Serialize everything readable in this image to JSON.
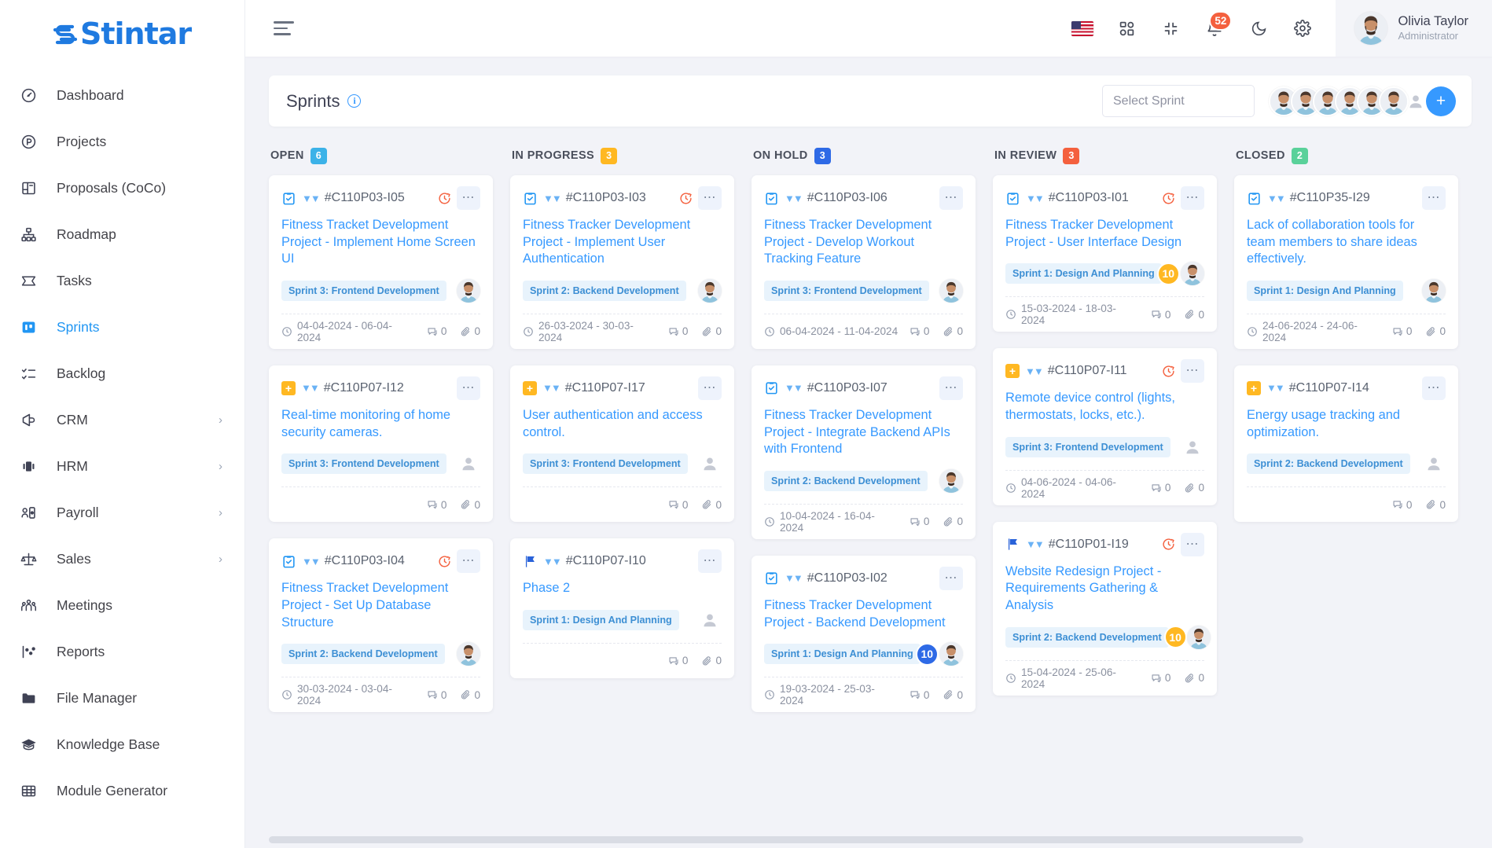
{
  "brand": {
    "name": "Stintar"
  },
  "sidebar": {
    "items": [
      {
        "label": "Dashboard",
        "icon": "gauge-icon",
        "active": false,
        "expandable": false
      },
      {
        "label": "Projects",
        "icon": "circle-p-icon",
        "active": false,
        "expandable": false
      },
      {
        "label": "Proposals (CoCo)",
        "icon": "layout-icon",
        "active": false,
        "expandable": false
      },
      {
        "label": "Roadmap",
        "icon": "sitemap-icon",
        "active": false,
        "expandable": false
      },
      {
        "label": "Tasks",
        "icon": "ticket-icon",
        "active": false,
        "expandable": false
      },
      {
        "label": "Sprints",
        "icon": "board-icon",
        "active": true,
        "expandable": false
      },
      {
        "label": "Backlog",
        "icon": "checklist-icon",
        "active": false,
        "expandable": false
      },
      {
        "label": "CRM",
        "icon": "megaphone-icon",
        "active": false,
        "expandable": true
      },
      {
        "label": "HRM",
        "icon": "id-card-icon",
        "active": false,
        "expandable": true
      },
      {
        "label": "Payroll",
        "icon": "user-card-icon",
        "active": false,
        "expandable": true
      },
      {
        "label": "Sales",
        "icon": "scale-icon",
        "active": false,
        "expandable": true
      },
      {
        "label": "Meetings",
        "icon": "people-icon",
        "active": false,
        "expandable": false
      },
      {
        "label": "Reports",
        "icon": "chart-icon",
        "active": false,
        "expandable": false
      },
      {
        "label": "File Manager",
        "icon": "folder-icon",
        "active": false,
        "expandable": false
      },
      {
        "label": "Knowledge Base",
        "icon": "graduation-cap-icon",
        "active": false,
        "expandable": false
      },
      {
        "label": "Module Generator",
        "icon": "grid-table-icon",
        "active": false,
        "expandable": false
      }
    ]
  },
  "topbar": {
    "menu_toggle": "hamburger-icon",
    "language_flag": "us-flag-icon",
    "apps_icon": "apps-grid-icon",
    "fullscreen_icon": "compress-icon",
    "notifications_icon": "bell-icon",
    "notifications_count": "52",
    "dark_mode_icon": "moon-icon",
    "settings_icon": "gear-icon",
    "user": {
      "name": "Olivia Taylor",
      "role": "Administrator"
    }
  },
  "page": {
    "title": "Sprints",
    "info_icon": "info-icon",
    "sprint_select_placeholder": "Select Sprint",
    "member_avatars": 6,
    "ghost_avatar": true,
    "add_member_label": "+"
  },
  "colors": {
    "open": "#3cb2e8",
    "in_progress": "#ffb822",
    "on_hold": "#2e6ae6",
    "in_review": "#f4603e",
    "closed": "#5ad19a",
    "accent": "#3699ff",
    "brand": "#1f7ae0"
  },
  "board": {
    "columns": [
      {
        "name": "OPEN",
        "count": "6",
        "badge_color": "#3cb2e8",
        "cards": [
          {
            "type_icon": "clipboard-check-icon",
            "code": "#C110P03-I05",
            "overdue": true,
            "title": "Fitness Tracket Development Project - Implement Home Screen UI",
            "sprint": "Sprint 3: Frontend Development",
            "badge": null,
            "badge_color": null,
            "assignee": "photo",
            "dates": "04-04-2024 - 06-04-2024",
            "comments": "0",
            "attachments": "0"
          },
          {
            "type_icon": "plus-square-icon",
            "code": "#C110P07-I12",
            "overdue": false,
            "title": "Real-time monitoring of home security cameras.",
            "sprint": "Sprint 3: Frontend Development",
            "badge": null,
            "badge_color": null,
            "assignee": "ghost",
            "dates": null,
            "comments": "0",
            "attachments": "0"
          },
          {
            "type_icon": "clipboard-check-icon",
            "code": "#C110P03-I04",
            "overdue": true,
            "title": "Fitness Tracket Development Project - Set Up Database Structure",
            "sprint": "Sprint 2: Backend Development",
            "badge": null,
            "badge_color": null,
            "assignee": "photo",
            "dates": "30-03-2024 - 03-04-2024",
            "comments": "0",
            "attachments": "0"
          }
        ]
      },
      {
        "name": "IN PROGRESS",
        "count": "3",
        "badge_color": "#ffb822",
        "cards": [
          {
            "type_icon": "clipboard-check-icon",
            "code": "#C110P03-I03",
            "overdue": true,
            "title": "Fitness Tracker Development Project - Implement User Authentication",
            "sprint": "Sprint 2: Backend Development",
            "badge": null,
            "badge_color": null,
            "assignee": "photo",
            "dates": "26-03-2024 - 30-03-2024",
            "comments": "0",
            "attachments": "0"
          },
          {
            "type_icon": "plus-square-icon",
            "code": "#C110P07-I17",
            "overdue": false,
            "title": "User authentication and access control.",
            "sprint": "Sprint 3: Frontend Development",
            "badge": null,
            "badge_color": null,
            "assignee": "ghost",
            "dates": null,
            "comments": "0",
            "attachments": "0"
          },
          {
            "type_icon": "flag-icon",
            "code": "#C110P07-I10",
            "overdue": false,
            "title": "Phase 2",
            "sprint": "Sprint 1: Design And Planning",
            "badge": null,
            "badge_color": null,
            "assignee": "ghost",
            "dates": null,
            "comments": "0",
            "attachments": "0"
          }
        ]
      },
      {
        "name": "ON HOLD",
        "count": "3",
        "badge_color": "#2e6ae6",
        "cards": [
          {
            "type_icon": "clipboard-check-icon",
            "code": "#C110P03-I06",
            "overdue": false,
            "title": "Fitness Tracker Development Project - Develop Workout Tracking Feature",
            "sprint": "Sprint 3: Frontend Development",
            "badge": null,
            "badge_color": null,
            "assignee": "photo",
            "dates": "06-04-2024 - 11-04-2024",
            "comments": "0",
            "attachments": "0"
          },
          {
            "type_icon": "clipboard-check-icon",
            "code": "#C110P03-I07",
            "overdue": false,
            "title": "Fitness Tracker Development Project - Integrate Backend APIs with Frontend",
            "sprint": "Sprint 2: Backend Development",
            "badge": null,
            "badge_color": null,
            "assignee": "photo",
            "dates": "10-04-2024 - 16-04-2024",
            "comments": "0",
            "attachments": "0"
          },
          {
            "type_icon": "clipboard-check-icon",
            "code": "#C110P03-I02",
            "overdue": false,
            "title": "Fitness Tracker Development Project - Backend Development",
            "sprint": "Sprint 1: Design And Planning",
            "badge": "10",
            "badge_color": "#2e6ae6",
            "assignee": "photo",
            "dates": "19-03-2024 - 25-03-2024",
            "comments": "0",
            "attachments": "0"
          }
        ]
      },
      {
        "name": "IN REVIEW",
        "count": "3",
        "badge_color": "#f4603e",
        "cards": [
          {
            "type_icon": "clipboard-check-icon",
            "code": "#C110P03-I01",
            "overdue": true,
            "title": "Fitness Tracker Development Project - User Interface Design",
            "sprint": "Sprint 1: Design And Planning",
            "badge": "10",
            "badge_color": "#ffb822",
            "assignee": "photo",
            "dates": "15-03-2024 - 18-03-2024",
            "comments": "0",
            "attachments": "0"
          },
          {
            "type_icon": "plus-square-icon",
            "code": "#C110P07-I11",
            "overdue": true,
            "title": "Remote device control (lights, thermostats, locks, etc.).",
            "sprint": "Sprint 3: Frontend Development",
            "badge": null,
            "badge_color": null,
            "assignee": "ghost",
            "dates": "04-06-2024 - 04-06-2024",
            "comments": "0",
            "attachments": "0"
          },
          {
            "type_icon": "flag-icon",
            "code": "#C110P01-I19",
            "overdue": true,
            "title": "Website Redesign Project - Requirements Gathering & Analysis",
            "sprint": "Sprint 2: Backend Development",
            "badge": "10",
            "badge_color": "#ffb822",
            "assignee": "photo",
            "dates": "15-04-2024 - 25-06-2024",
            "comments": "0",
            "attachments": "0"
          }
        ]
      },
      {
        "name": "CLOSED",
        "count": "2",
        "badge_color": "#5ad19a",
        "cards": [
          {
            "type_icon": "clipboard-check-icon",
            "code": "#C110P35-I29",
            "overdue": false,
            "title": "Lack of collaboration tools for team members to share ideas effectively.",
            "sprint": "Sprint 1: Design And Planning",
            "badge": null,
            "badge_color": null,
            "assignee": "photo",
            "dates": "24-06-2024 - 24-06-2024",
            "comments": "0",
            "attachments": "0"
          },
          {
            "type_icon": "plus-square-icon",
            "code": "#C110P07-I14",
            "overdue": false,
            "title": "Energy usage tracking and optimization.",
            "sprint": "Sprint 2: Backend Development",
            "badge": null,
            "badge_color": null,
            "assignee": "ghost",
            "dates": null,
            "comments": "0",
            "attachments": "0"
          }
        ]
      }
    ]
  }
}
